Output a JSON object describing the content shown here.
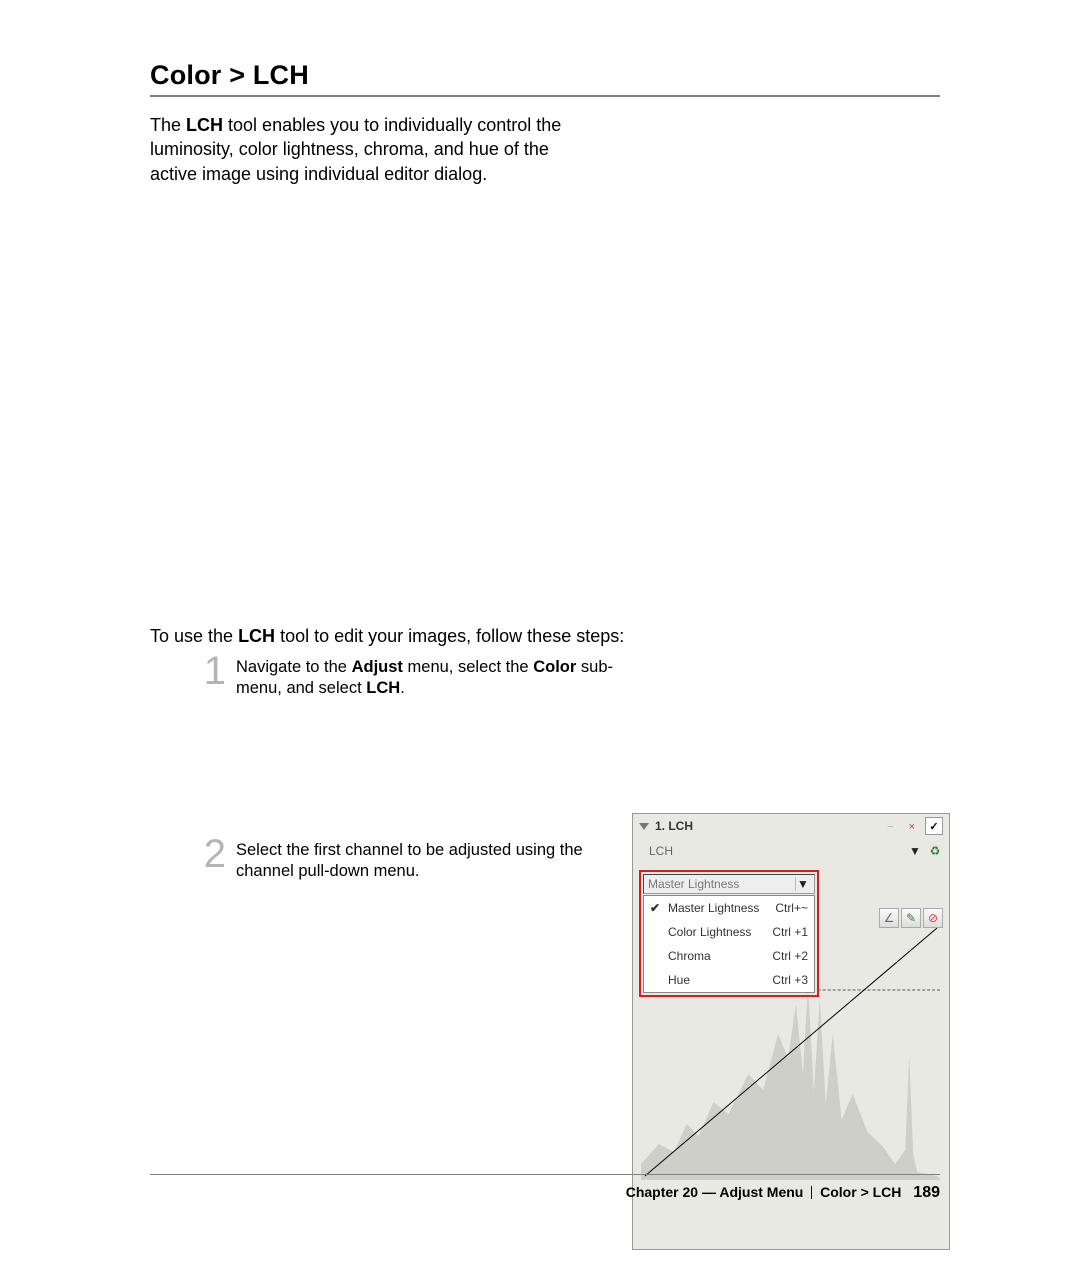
{
  "heading": "Color > LCH",
  "intro_pre": "The ",
  "intro_bold": "LCH",
  "intro_post": " tool enables you to individually control the luminosity, color lightness, chroma, and hue of the active image using individual editor dialog.",
  "lead_pre": "To use the ",
  "lead_bold": "LCH",
  "lead_post": " tool to edit your images, follow these steps:",
  "steps": {
    "s1": {
      "num": "1",
      "t1": "Navigate to the",
      "b1": "Adjust",
      "t2": " menu, select the",
      "b2": "Color",
      "t3": " sub-menu, and select",
      "b3": "LCH",
      "t4": "."
    },
    "s2": {
      "num": "2",
      "txt": "Select the first channel to be adjusted using the channel pull-down menu."
    }
  },
  "panel": {
    "title": "1. LCH",
    "sub": "LCH",
    "combo": "Master Lightness",
    "menu": [
      {
        "chk": "✔",
        "lbl": "Master Lightness",
        "sc": "Ctrl+~"
      },
      {
        "chk": "",
        "lbl": "Color Lightness",
        "sc": "Ctrl +1"
      },
      {
        "chk": "",
        "lbl": "Chroma",
        "sc": "Ctrl +2"
      },
      {
        "chk": "",
        "lbl": "Hue",
        "sc": "Ctrl +3"
      }
    ],
    "icons": {
      "minus": "−",
      "close_x": "×",
      "check": "✓",
      "dropdown": "▼",
      "recycle": "♻",
      "line": "∠",
      "pencil": "✎",
      "no": "⊘"
    }
  },
  "footer": {
    "ch": "Chapter 20 — Adjust Menu",
    "crumb": "Color > LCH",
    "page": "189"
  }
}
